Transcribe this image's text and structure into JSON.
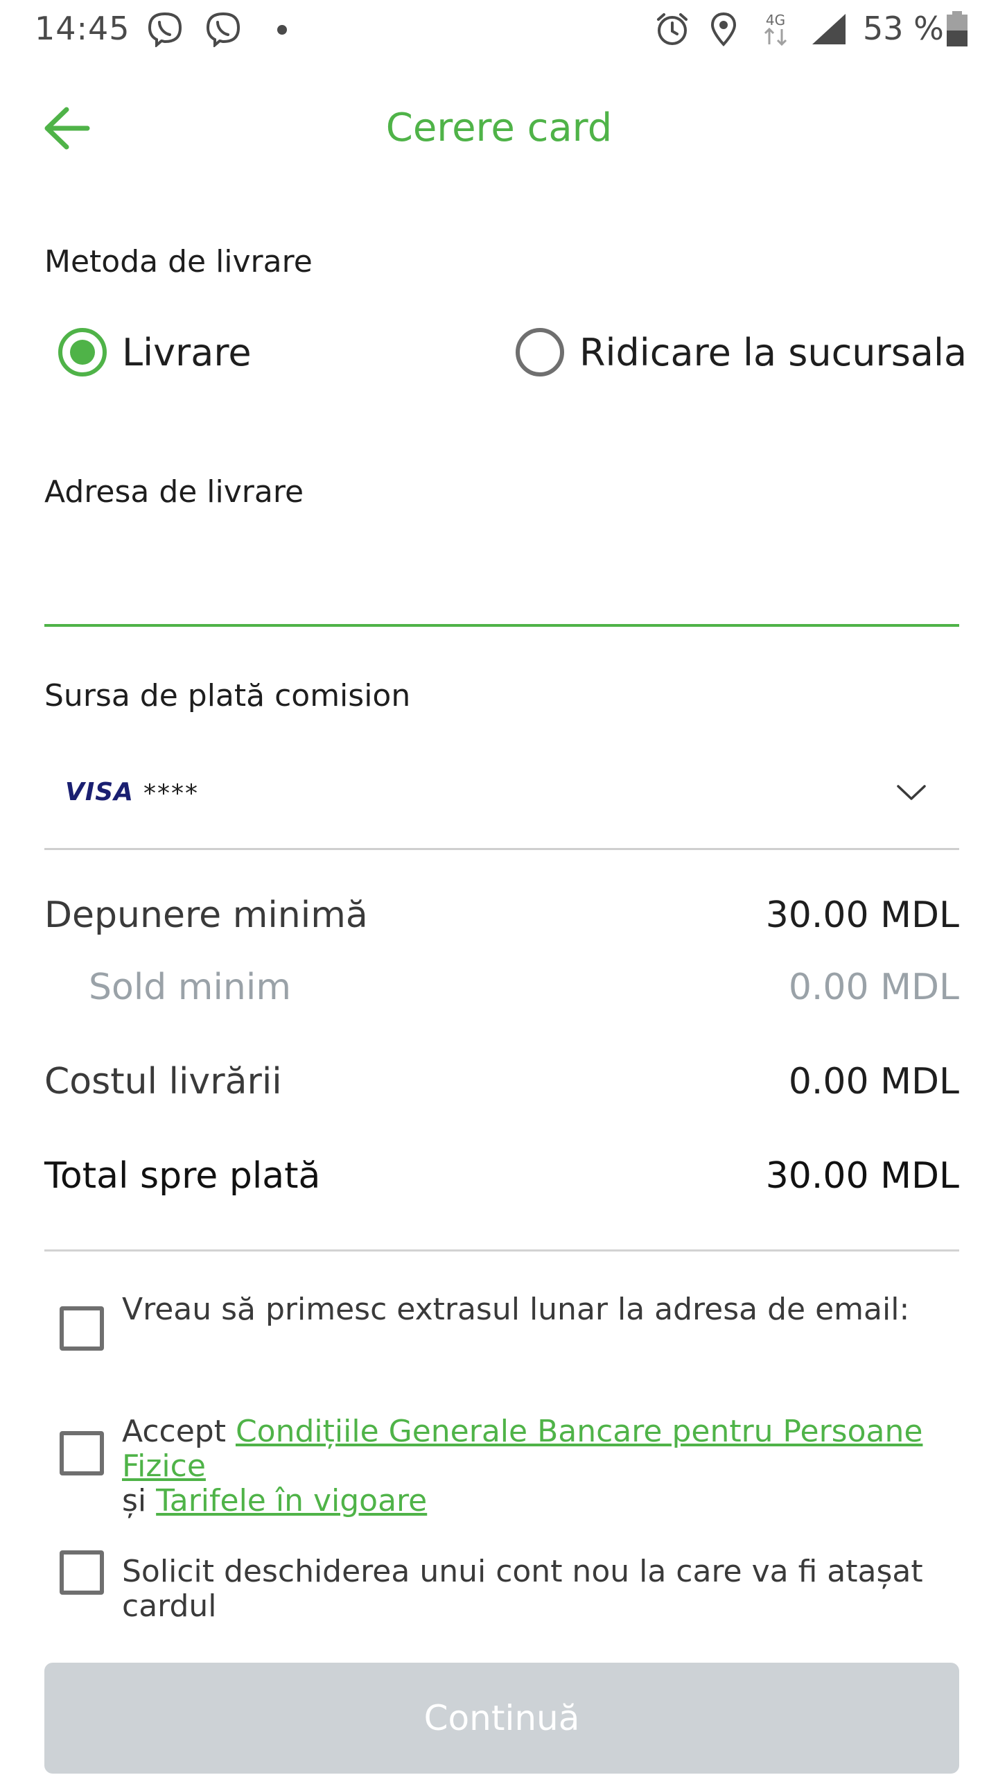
{
  "status_bar": {
    "time": "14:45",
    "battery_percent": "53 %",
    "network": "4G",
    "icons": [
      "viber-icon",
      "viber-icon",
      "dot-icon",
      "alarm-icon",
      "location-icon",
      "network-4g-icon",
      "signal-icon",
      "battery-icon"
    ]
  },
  "header": {
    "title": "Cerere card"
  },
  "delivery_method": {
    "label": "Metoda de livrare",
    "options": [
      {
        "label": "Livrare",
        "selected": true
      },
      {
        "label": "Ridicare la sucursala",
        "selected": false
      }
    ]
  },
  "address": {
    "label": "Adresa de livrare",
    "value": ""
  },
  "payment_source": {
    "label": "Sursa de plată comision",
    "card_brand": "VISA",
    "card_mask": "****"
  },
  "summary": {
    "min_deposit_label": "Depunere minimă",
    "min_deposit_value": "30.00 MDL",
    "min_balance_label": "Sold minim",
    "min_balance_value": "0.00 MDL",
    "delivery_cost_label": "Costul livrării",
    "delivery_cost_value": "0.00 MDL",
    "total_label": "Total spre plată",
    "total_value": "30.00 MDL"
  },
  "checkboxes": {
    "email_statement": "Vreau să primesc extrasul lunar la adresa de email:",
    "accept_prefix": "Accept ",
    "accept_terms_link": "Condițiile Generale Bancare pentru Persoane Fizice",
    "accept_middle": "și ",
    "accept_tariffs_link": "Tarifele în vigoare",
    "new_account": "Solicit deschiderea unui cont nou la care va fi atașat cardul"
  },
  "continue_label": "Continuă",
  "colors": {
    "accent": "#4fb348",
    "button_disabled": "#cdd2d6",
    "muted_text": "#9aa2a8",
    "visa_blue": "#1a1f71"
  }
}
